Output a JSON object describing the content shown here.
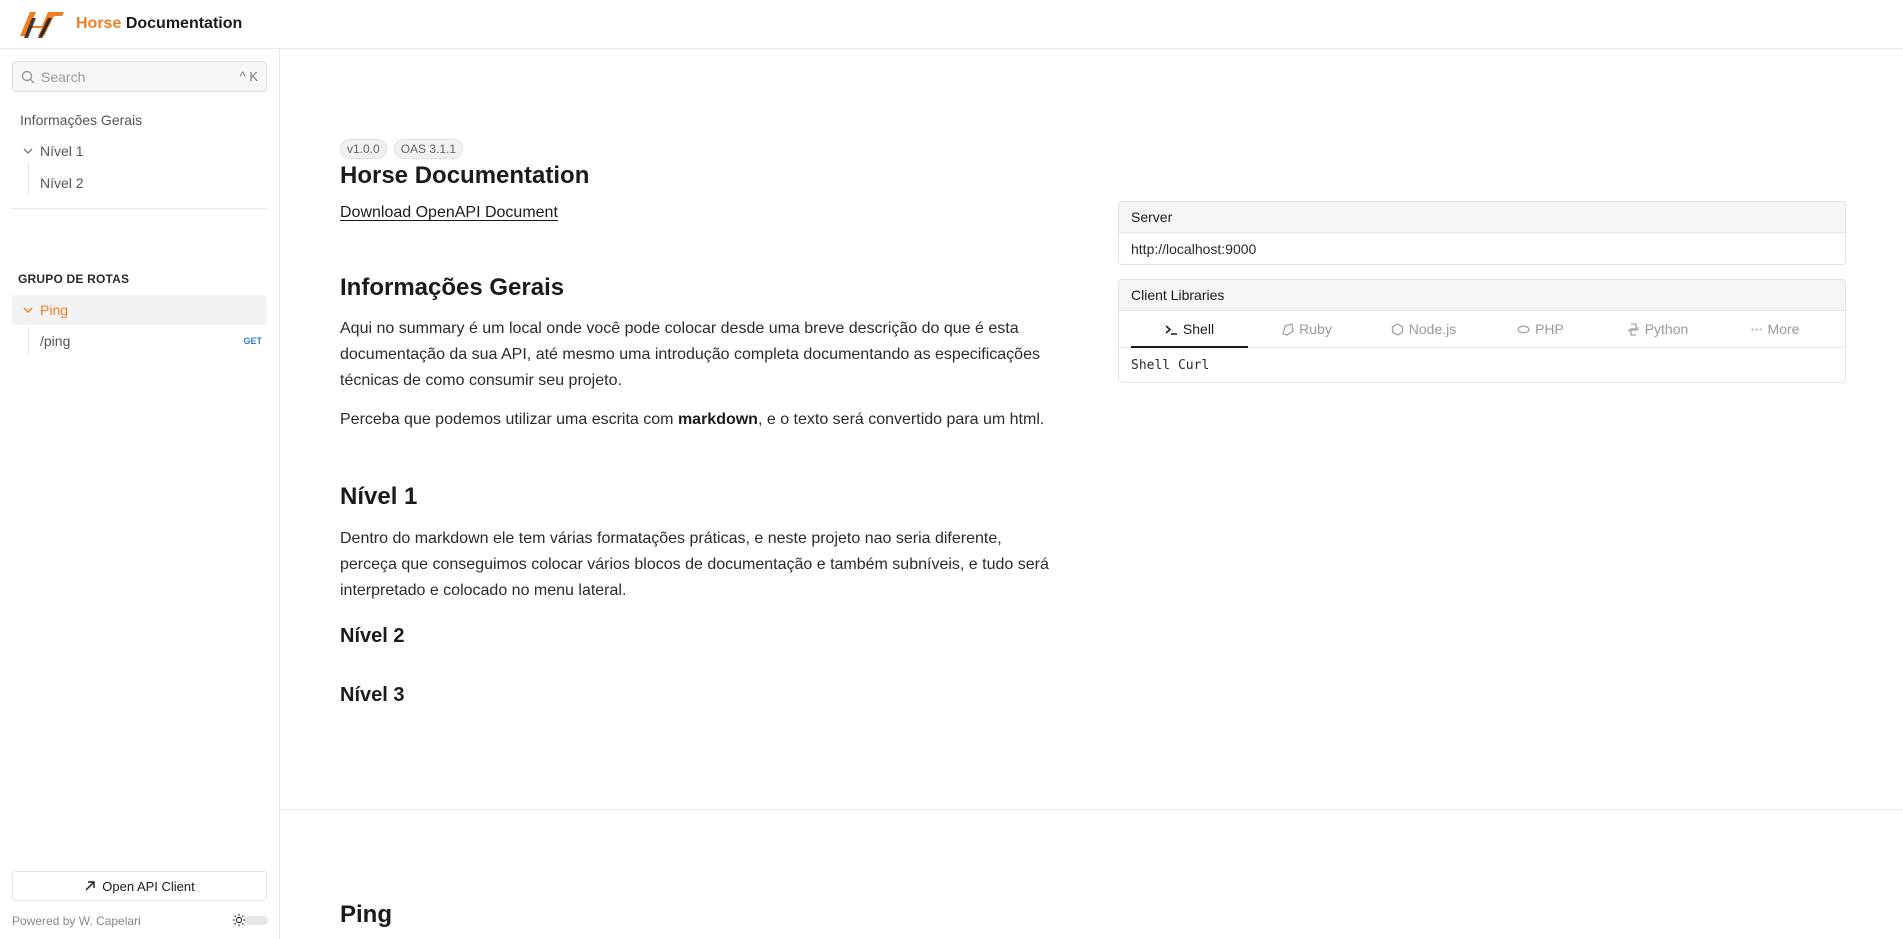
{
  "header": {
    "brand_accent": "Horse",
    "brand_rest": "Documentation",
    "accent_color": "#f07e22"
  },
  "sidebar": {
    "search": {
      "placeholder": "Search",
      "shortcut": "^ K",
      "icon": "search-icon"
    },
    "items": [
      {
        "label": "Informações Gerais"
      },
      {
        "label": "Nível 1",
        "expanded": true
      },
      {
        "label": "Nível 2"
      }
    ],
    "group_title": "GRUPO DE ROTAS",
    "group": {
      "label": "Ping",
      "expanded": true,
      "routes": [
        {
          "path": "/ping",
          "method": "GET"
        }
      ]
    },
    "open_client_label": "Open API Client",
    "powered_by": "Powered by W. Capelari"
  },
  "main": {
    "badges": [
      "v1.0.0",
      "OAS 3.1.1"
    ],
    "title": "Horse Documentation",
    "download_label": "Download OpenAPI Document",
    "sections": {
      "info_title": "Informações Gerais",
      "info_p1": "Aqui no summary é um local onde você pode colocar desde uma breve descrição do que é esta documentação da sua API, até mesmo uma introdução completa documentando as especificações técnicas de como consumir seu projeto.",
      "info_p2_before": "Perceba que podemos utilizar uma escrita com ",
      "info_p2_bold": "markdown",
      "info_p2_after": ", e o texto será convertido para um html.",
      "nivel1_title": "Nível 1",
      "nivel1_p": "Dentro do markdown ele tem várias formatações práticas, e neste projeto nao seria diferente, perceça que conseguimos colocar vários blocos de documentação e também subníveis, e tudo será interpretado e colocado no menu lateral.",
      "nivel2_title": "Nível 2",
      "nivel3_title": "Nível 3"
    },
    "ping_title": "Ping",
    "server": {
      "label": "Server",
      "url": "http://localhost:9000"
    },
    "client_libraries": {
      "label": "Client Libraries",
      "tabs": [
        {
          "label": "Shell",
          "icon": "terminal-icon",
          "active": true
        },
        {
          "label": "Ruby",
          "icon": "ruby-icon",
          "active": false
        },
        {
          "label": "Node.js",
          "icon": "nodejs-icon",
          "active": false
        },
        {
          "label": "PHP",
          "icon": "php-icon",
          "active": false
        },
        {
          "label": "Python",
          "icon": "python-icon",
          "active": false
        },
        {
          "label": "More",
          "icon": "more-icon",
          "active": false
        }
      ],
      "selected": "Shell Curl"
    }
  }
}
